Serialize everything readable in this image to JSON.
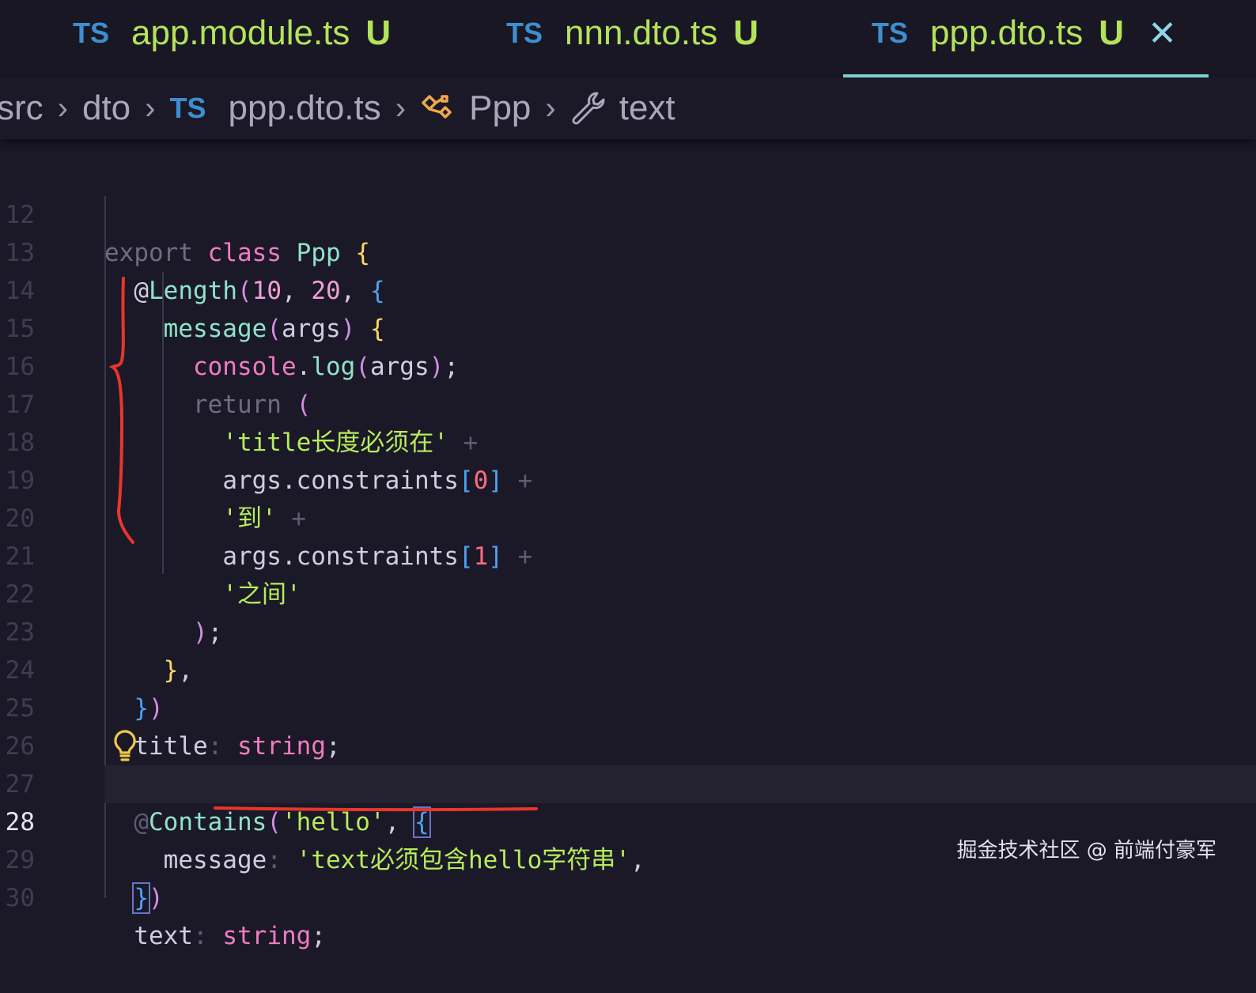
{
  "tabs": [
    {
      "lang": "TS",
      "name": "app.module.ts",
      "status": "U"
    },
    {
      "lang": "TS",
      "name": "nnn.dto.ts",
      "status": "U"
    },
    {
      "lang": "TS",
      "name": "ppp.dto.ts",
      "status": "U",
      "close": "✕",
      "active": true
    }
  ],
  "breadcrumb": {
    "items": [
      "src",
      "dto",
      "ppp.dto.ts",
      "Ppp",
      "text"
    ],
    "ts_badge": "TS",
    "separator": "›",
    "icons": [
      "chevron-right-icon",
      "class-icon",
      "wrench-icon"
    ]
  },
  "editor": {
    "active_line": 28,
    "line_numbers": [
      "12",
      "13",
      "14",
      "15",
      "16",
      "17",
      "18",
      "19",
      "20",
      "21",
      "22",
      "23",
      "24",
      "25",
      "26",
      "27",
      "28",
      "29",
      "30"
    ],
    "code": {
      "l12": {
        "kw1": "export",
        "kw2": "class",
        "name": "Ppp",
        "brace": "{"
      },
      "l13": {
        "at": "@",
        "dec": "Length",
        "p1": "(",
        "n1": "10",
        "c1": ",",
        "n2": "20",
        "c2": ",",
        "b": "{"
      },
      "l14": {
        "fn": "message",
        "p1": "(",
        "arg": "args",
        "p2": ")",
        "b": "{"
      },
      "l15": {
        "obj": "console",
        "dot": ".",
        "fn": "log",
        "p1": "(",
        "arg": "args",
        "p2": ")",
        "semi": ";"
      },
      "l16": {
        "kw": "return",
        "p": "("
      },
      "l17": {
        "str": "'title长度必须在'",
        "op": "+"
      },
      "l18": {
        "obj": "args.constraints",
        "b1": "[",
        "idx": "0",
        "b2": "]",
        "op": "+"
      },
      "l19": {
        "str": "'到'",
        "op": "+"
      },
      "l20": {
        "obj": "args.constraints",
        "b1": "[",
        "idx": "1",
        "b2": "]",
        "op": "+"
      },
      "l21": {
        "str": "'之间'"
      },
      "l22": {
        "p": ")",
        "semi": ";"
      },
      "l23": {
        "b": "}",
        "c": ","
      },
      "l24": {
        "b": "}",
        "p": ")"
      },
      "l25": {
        "prop": "title",
        "colon": ":",
        "type": "string",
        "semi": ";"
      },
      "l27": {
        "at": "@",
        "dec": "Contains",
        "p1": "(",
        "str": "'hello'",
        "c": ",",
        "b": "{"
      },
      "l28": {
        "prop": "message",
        "colon": ":",
        "str": "'text必须包含hello字符串'",
        "c": ","
      },
      "l29": {
        "b": "}",
        "p": ")"
      },
      "l30": {
        "prop": "text",
        "colon": ":",
        "type": "string",
        "semi": ";"
      }
    }
  },
  "watermark": "掘金技术社区 @ 前端付豪军",
  "colors": {
    "background": "#1b1928",
    "ts_badge": "#3d8fd1",
    "file_name": "#b3e35a",
    "tab_underline": "#7fd6d8",
    "annotation_red": "#e8362c",
    "lightbulb": "#f2c94c"
  }
}
